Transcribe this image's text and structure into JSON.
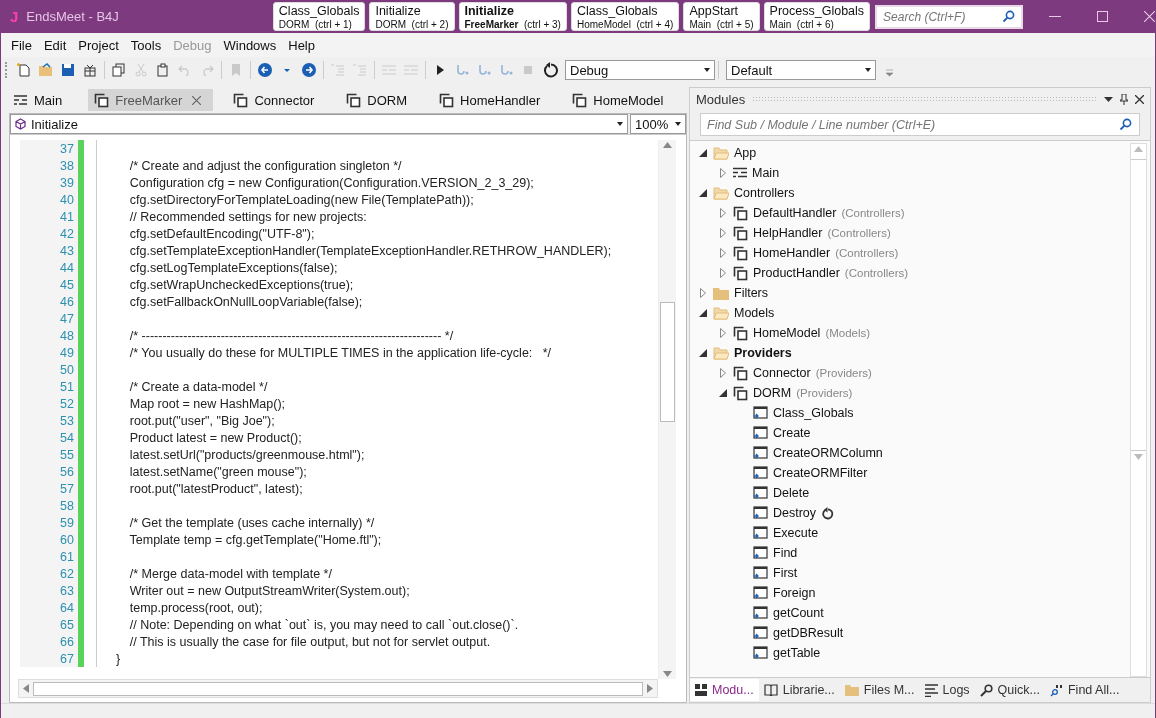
{
  "window": {
    "logo": "J",
    "title": "EndsMeet - B4J"
  },
  "quick_tabs": [
    {
      "title": "Class_Globals",
      "module": "DORM",
      "shortcut": "(ctrl + 1)",
      "selected": false
    },
    {
      "title": "Initialize",
      "module": "DORM",
      "shortcut": "(ctrl + 2)",
      "selected": false
    },
    {
      "title": "Initialize",
      "module": "FreeMarker",
      "shortcut": "(ctrl + 3)",
      "selected": true
    },
    {
      "title": "Class_Globals",
      "module": "HomeModel",
      "shortcut": "(ctrl + 4)",
      "selected": false
    },
    {
      "title": "AppStart",
      "module": "Main",
      "shortcut": "(ctrl + 5)",
      "selected": false
    },
    {
      "title": "Process_Globals",
      "module": "Main",
      "shortcut": "(ctrl + 6)",
      "selected": false
    }
  ],
  "title_search": {
    "placeholder": "Search (Ctrl+F)"
  },
  "menu": [
    {
      "label": "File",
      "disabled": false
    },
    {
      "label": "Edit",
      "disabled": false
    },
    {
      "label": "Project",
      "disabled": false
    },
    {
      "label": "Tools",
      "disabled": false
    },
    {
      "label": "Debug",
      "disabled": true
    },
    {
      "label": "Windows",
      "disabled": false
    },
    {
      "label": "Help",
      "disabled": false
    }
  ],
  "toolbar": [
    {
      "kind": "new",
      "disabled": false
    },
    {
      "kind": "open",
      "disabled": false
    },
    {
      "kind": "save",
      "disabled": false
    },
    {
      "kind": "package",
      "disabled": false
    },
    {
      "kind": "sep"
    },
    {
      "kind": "copy",
      "disabled": false
    },
    {
      "kind": "cut",
      "disabled": true
    },
    {
      "kind": "paste",
      "disabled": false
    },
    {
      "kind": "undo",
      "disabled": true
    },
    {
      "kind": "redo",
      "disabled": true
    },
    {
      "kind": "sep"
    },
    {
      "kind": "bookmark",
      "disabled": true
    },
    {
      "kind": "sep"
    },
    {
      "kind": "back",
      "disabled": false
    },
    {
      "kind": "dropdown",
      "disabled": false
    },
    {
      "kind": "forward",
      "disabled": false
    },
    {
      "kind": "sep"
    },
    {
      "kind": "comment",
      "disabled": true
    },
    {
      "kind": "uncomment",
      "disabled": true
    },
    {
      "kind": "sep"
    },
    {
      "kind": "outdent",
      "disabled": true
    },
    {
      "kind": "indent",
      "disabled": true
    },
    {
      "kind": "sep"
    },
    {
      "kind": "run",
      "disabled": false
    },
    {
      "kind": "step_in",
      "disabled": true
    },
    {
      "kind": "step_over",
      "disabled": true
    },
    {
      "kind": "step_out",
      "disabled": true
    },
    {
      "kind": "stop",
      "disabled": true
    },
    {
      "kind": "restart",
      "disabled": false
    }
  ],
  "build_config": {
    "value": "Debug"
  },
  "theme_select": {
    "value": "Default"
  },
  "doc_tabs": [
    {
      "label": "Main",
      "kind": "main",
      "selected": false
    },
    {
      "label": "FreeMarker",
      "kind": "class",
      "selected": true
    },
    {
      "label": "Connector",
      "kind": "class",
      "selected": false
    },
    {
      "label": "DORM",
      "kind": "class",
      "selected": false
    },
    {
      "label": "HomeHandler",
      "kind": "class",
      "selected": false
    },
    {
      "label": "HomeModel",
      "kind": "class",
      "selected": false
    }
  ],
  "sub_select": {
    "value": "Initialize"
  },
  "zoom_select": {
    "value": "100%"
  },
  "code_lines": [
    {
      "number": "37"
    },
    {
      "number": "38",
      "text": "        /* Create and adjust the configuration singleton */"
    },
    {
      "number": "39",
      "text": "        Configuration cfg = new Configuration(Configuration.VERSION_2_3_29);"
    },
    {
      "number": "40",
      "text": "        cfg.setDirectoryForTemplateLoading(new File(TemplatePath));"
    },
    {
      "number": "41",
      "text": "        // Recommended settings for new projects:"
    },
    {
      "number": "42",
      "text": "        cfg.setDefaultEncoding(\"UTF-8\");"
    },
    {
      "number": "43",
      "text": "        cfg.setTemplateExceptionHandler(TemplateExceptionHandler.RETHROW_HANDLER);"
    },
    {
      "number": "44",
      "text": "        cfg.setLogTemplateExceptions(false);"
    },
    {
      "number": "45",
      "text": "        cfg.setWrapUncheckedExceptions(true);"
    },
    {
      "number": "46",
      "text": "        cfg.setFallbackOnNullLoopVariable(false);"
    },
    {
      "number": "47"
    },
    {
      "number": "48",
      "text": "        /* ------------------------------------------------------------------------ */"
    },
    {
      "number": "49",
      "text": "        /* You usually do these for MULTIPLE TIMES in the application life-cycle:   */"
    },
    {
      "number": "50"
    },
    {
      "number": "51",
      "text": "        /* Create a data-model */"
    },
    {
      "number": "52",
      "text": "        Map root = new HashMap();"
    },
    {
      "number": "53",
      "text": "        root.put(\"user\", \"Big Joe\");"
    },
    {
      "number": "54",
      "text": "        Product latest = new Product();"
    },
    {
      "number": "55",
      "text": "        latest.setUrl(\"products/greenmouse.html\");"
    },
    {
      "number": "56",
      "text": "        latest.setName(\"green mouse\");"
    },
    {
      "number": "57",
      "text": "        root.put(\"latestProduct\", latest);"
    },
    {
      "number": "58"
    },
    {
      "number": "59",
      "text": "        /* Get the template (uses cache internally) */"
    },
    {
      "number": "60",
      "text": "        Template temp = cfg.getTemplate(\"Home.ftl\");"
    },
    {
      "number": "61"
    },
    {
      "number": "62",
      "text": "        /* Merge data-model with template */"
    },
    {
      "number": "63",
      "text": "        Writer out = new OutputStreamWriter(System.out);"
    },
    {
      "number": "64",
      "text": "        temp.process(root, out);"
    },
    {
      "number": "65",
      "text": "        // Note: Depending on what `out` is, you may need to call `out.close()`."
    },
    {
      "number": "66",
      "text": "        // This is usually the case for file output, but not for servlet output."
    },
    {
      "number": "67",
      "text": "    }"
    }
  ],
  "modules_panel": {
    "title": "Modules",
    "search": {
      "placeholder": "Find Sub / Module / Line number (Ctrl+E)"
    },
    "tree": [
      {
        "label": "App",
        "kind": "folder",
        "expanded": true,
        "bold": false,
        "children": [
          {
            "label": "Main",
            "kind": "main",
            "expanded": false,
            "bold": false
          }
        ]
      },
      {
        "label": "Controllers",
        "kind": "folder",
        "expanded": true,
        "bold": false,
        "children": [
          {
            "label": "DefaultHandler",
            "group": "(Controllers)",
            "kind": "class",
            "expanded": false,
            "bold": false
          },
          {
            "label": "HelpHandler",
            "group": "(Controllers)",
            "kind": "class",
            "expanded": false,
            "bold": false
          },
          {
            "label": "HomeHandler",
            "group": "(Controllers)",
            "kind": "class",
            "expanded": false,
            "bold": false
          },
          {
            "label": "ProductHandler",
            "group": "(Controllers)",
            "kind": "class",
            "expanded": false,
            "bold": false
          }
        ]
      },
      {
        "label": "Filters",
        "kind": "folder",
        "expanded": false,
        "bold": false
      },
      {
        "label": "Models",
        "kind": "folder",
        "expanded": true,
        "bold": false,
        "children": [
          {
            "label": "HomeModel",
            "group": "(Models)",
            "kind": "class",
            "expanded": false,
            "bold": false
          }
        ]
      },
      {
        "label": "Providers",
        "kind": "folder",
        "expanded": true,
        "bold": true,
        "children": [
          {
            "label": "Connector",
            "group": "(Providers)",
            "kind": "class",
            "expanded": false,
            "bold": false
          },
          {
            "label": "DORM",
            "group": "(Providers)",
            "kind": "class",
            "expanded": true,
            "bold": false,
            "children": [
              {
                "label": "Class_Globals",
                "kind": "sub",
                "resumable": false
              },
              {
                "label": "Create",
                "kind": "sub",
                "resumable": false
              },
              {
                "label": "CreateORMColumn",
                "kind": "sub",
                "resumable": false
              },
              {
                "label": "CreateORMFilter",
                "kind": "sub",
                "resumable": false
              },
              {
                "label": "Delete",
                "kind": "sub",
                "resumable": false
              },
              {
                "label": "Destroy",
                "kind": "sub",
                "resumable": true
              },
              {
                "label": "Execute",
                "kind": "sub",
                "resumable": false
              },
              {
                "label": "Find",
                "kind": "sub",
                "resumable": false
              },
              {
                "label": "First",
                "kind": "sub",
                "resumable": false
              },
              {
                "label": "Foreign",
                "kind": "sub",
                "resumable": false
              },
              {
                "label": "getCount",
                "kind": "sub",
                "resumable": false
              },
              {
                "label": "getDBResult",
                "kind": "sub",
                "resumable": false
              },
              {
                "label": "getTable",
                "kind": "sub",
                "resumable": false
              }
            ]
          }
        ]
      }
    ],
    "tabs": [
      {
        "label": "Modu...",
        "kind": "modules",
        "selected": true
      },
      {
        "label": "Librarie...",
        "kind": "libraries",
        "selected": false
      },
      {
        "label": "Files M...",
        "kind": "files",
        "selected": false
      },
      {
        "label": "Logs",
        "kind": "logs",
        "selected": false
      },
      {
        "label": "Quick...",
        "kind": "quick",
        "selected": false
      },
      {
        "label": "Find All...",
        "kind": "find",
        "selected": false
      }
    ]
  }
}
